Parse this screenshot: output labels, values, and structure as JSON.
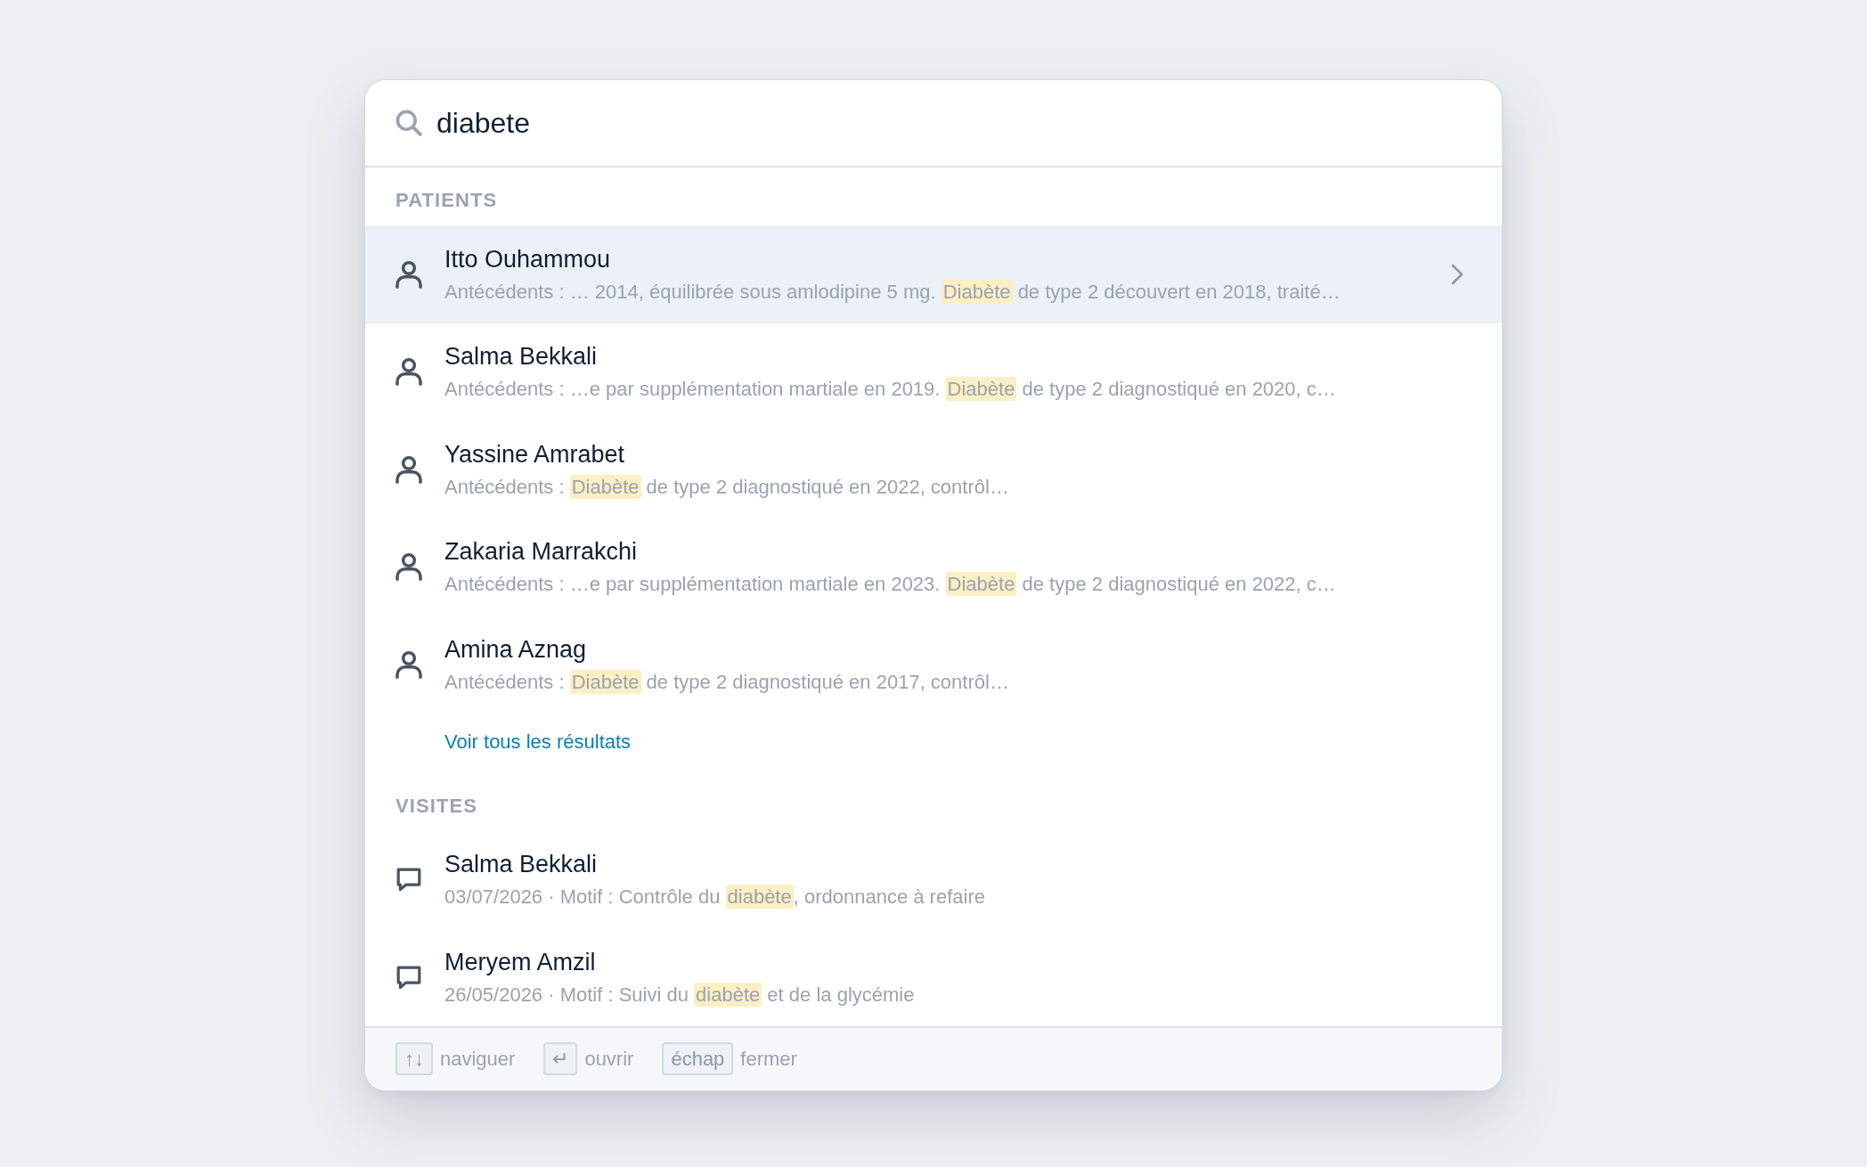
{
  "search": {
    "value": "diabete"
  },
  "sections": [
    {
      "title": "PATIENTS",
      "kind": "patient",
      "items": [
        {
          "name": "Itto Ouhammou",
          "selected": true,
          "snippet": {
            "before": "Antécédents : … 2014, équilibrée sous amlodipine 5 mg. ",
            "match": "Diabète",
            "after": " de type 2 découvert en 2018, traité…"
          }
        },
        {
          "name": "Salma Bekkali",
          "selected": false,
          "snippet": {
            "before": "Antécédents : …e par supplémentation martiale en 2019. ",
            "match": "Diabète",
            "after": " de type 2 diagnostiqué en 2020, c…"
          }
        },
        {
          "name": "Yassine Amrabet",
          "selected": false,
          "snippet": {
            "before": "Antécédents : ",
            "match": "Diabète",
            "after": " de type 2 diagnostiqué en 2022, contrôl…"
          }
        },
        {
          "name": "Zakaria Marrakchi",
          "selected": false,
          "snippet": {
            "before": "Antécédents : …e par supplémentation martiale en 2023. ",
            "match": "Diabète",
            "after": " de type 2 diagnostiqué en 2022, c…"
          }
        },
        {
          "name": "Amina Aznag",
          "selected": false,
          "snippet": {
            "before": "Antécédents : ",
            "match": "Diabète",
            "after": " de type 2 diagnostiqué en 2017, contrôl…"
          }
        }
      ],
      "more_link": "Voir tous les résultats"
    },
    {
      "title": "VISITES",
      "kind": "visit",
      "items": [
        {
          "name": "Salma Bekkali",
          "selected": false,
          "snippet": {
            "before": "03/07/2026 · Motif : Contrôle du ",
            "match": "diabète",
            "after": ", ordonnance à refaire"
          }
        },
        {
          "name": "Meryem Amzil",
          "selected": false,
          "snippet": {
            "before": "26/05/2026 · Motif : Suivi du ",
            "match": "diabète",
            "after": " et de la glycémie"
          }
        }
      ]
    }
  ],
  "shortcuts": [
    {
      "key": "↑↓",
      "label": "naviguer"
    },
    {
      "key": "↵",
      "label": "ouvrir"
    },
    {
      "key": "échap",
      "label": "fermer"
    }
  ]
}
